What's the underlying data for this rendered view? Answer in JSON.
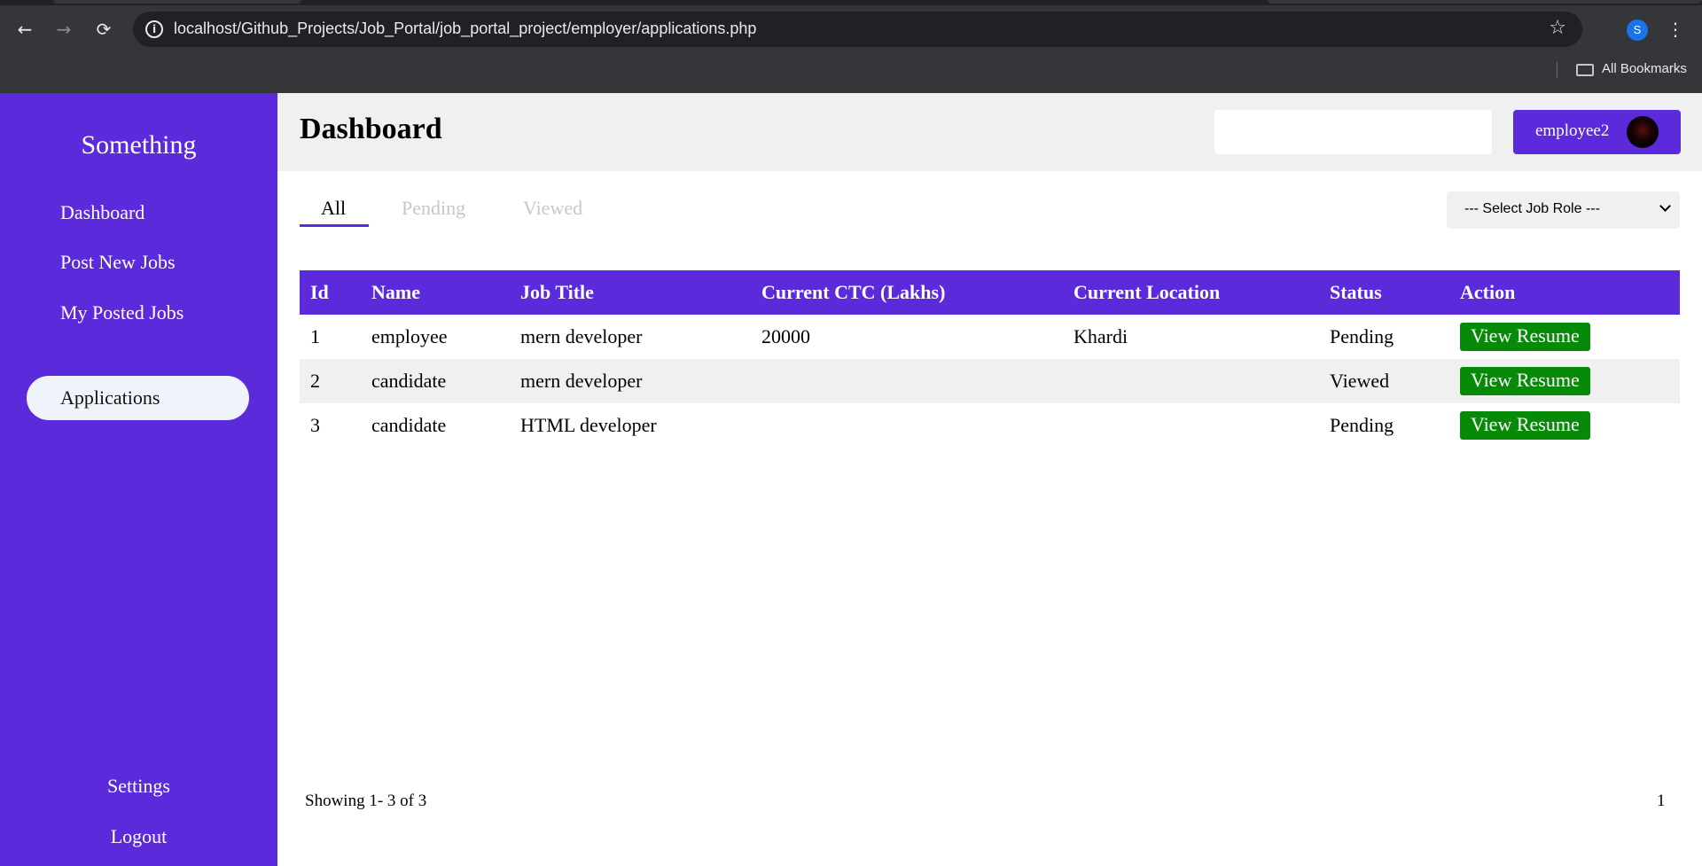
{
  "browser": {
    "url": "localhost/Github_Projects/Job_Portal/job_portal_project/employer/applications.php",
    "profile_initial": "S",
    "bookmarks_label": "All Bookmarks"
  },
  "sidebar": {
    "brand": "Something",
    "items": [
      {
        "label": "Dashboard"
      },
      {
        "label": "Post New Jobs"
      },
      {
        "label": "My Posted Jobs"
      },
      {
        "label": "Applications"
      }
    ],
    "active_item": "Applications",
    "settings_label": "Settings",
    "logout_label": "Logout"
  },
  "header": {
    "title": "Dashboard",
    "search_value": "",
    "user_name": "employee2"
  },
  "filters": {
    "tabs": [
      {
        "label": "All"
      },
      {
        "label": "Pending"
      },
      {
        "label": "Viewed"
      }
    ],
    "active_tab": "All",
    "job_role_select": "--- Select Job Role ---"
  },
  "table": {
    "columns": [
      "Id",
      "Name",
      "Job Title",
      "Current CTC (Lakhs)",
      "Current Location",
      "Status",
      "Action"
    ],
    "rows": [
      {
        "id": "1",
        "name": "employee",
        "job_title": "mern developer",
        "ctc": "20000",
        "location": "Khardi",
        "status": "Pending",
        "action": "View Resume"
      },
      {
        "id": "2",
        "name": "candidate",
        "job_title": "mern developer",
        "ctc": "",
        "location": "",
        "status": "Viewed",
        "action": "View Resume"
      },
      {
        "id": "3",
        "name": "candidate",
        "job_title": "HTML developer",
        "ctc": "",
        "location": "",
        "status": "Pending",
        "action": "View Resume"
      }
    ]
  },
  "footer": {
    "showing": "Showing 1- 3 of 3",
    "page": "1"
  },
  "colors": {
    "primary": "#5b2bdb",
    "action_button": "#078a07",
    "alt_row": "#f0f0f0"
  }
}
